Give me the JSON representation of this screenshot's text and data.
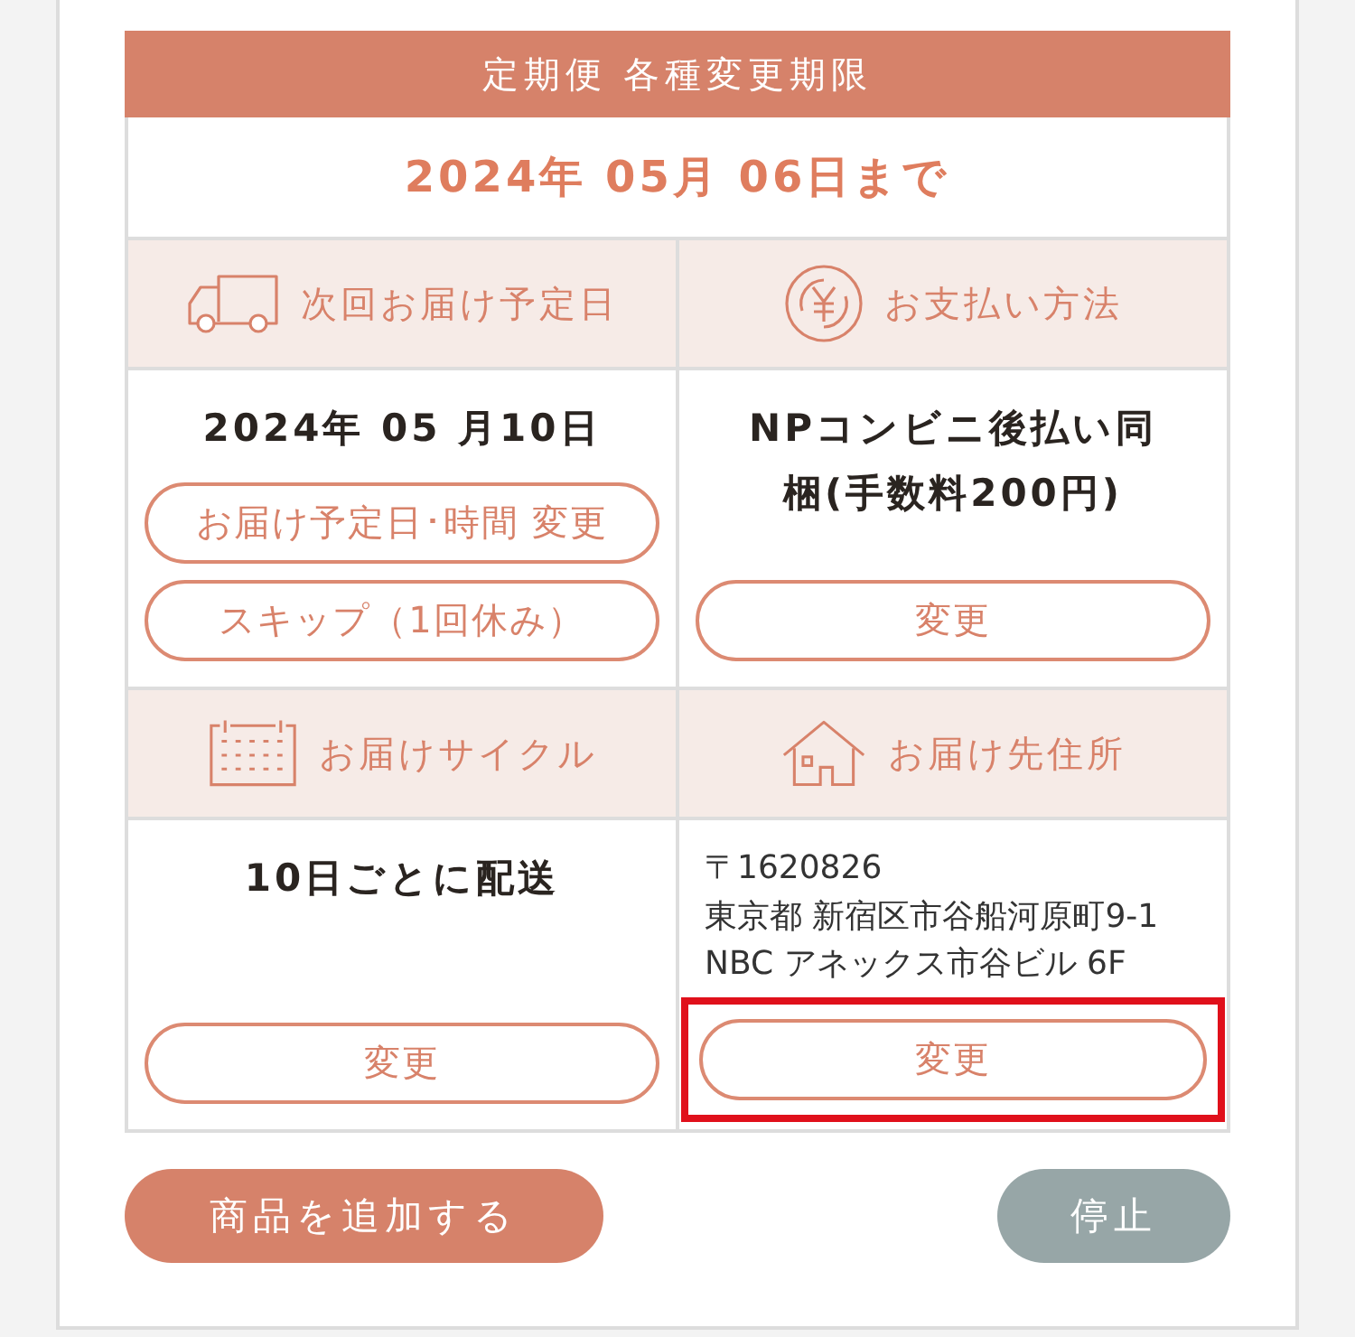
{
  "header": {
    "title": "定期便 各種変更期限",
    "deadline": "2024年 05月 06日まで"
  },
  "sections": [
    {
      "kind": "schedule",
      "label": "次回お届け予定日",
      "value": "2024年 05 月10日",
      "buttons": [
        {
          "label": "お届け予定日･時間 変更",
          "highlighted": false
        },
        {
          "label": "スキップ（1回休み）",
          "highlighted": false
        }
      ]
    },
    {
      "kind": "payment",
      "label": "お支払い方法",
      "value": "NPコンビニ後払い同梱(手数料200円)",
      "buttons": [
        {
          "label": "変更",
          "highlighted": false
        }
      ]
    },
    {
      "kind": "cycle",
      "label": "お届けサイクル",
      "value": "10日ごとに配送",
      "buttons": [
        {
          "label": "変更",
          "highlighted": false
        }
      ]
    },
    {
      "kind": "address",
      "label": "お届け先住所",
      "lines": [
        "〒1620826",
        "東京都 新宿区市谷船河原町9-1",
        "NBC アネックス市谷ビル 6F"
      ],
      "buttons": [
        {
          "label": "変更",
          "highlighted": true
        }
      ]
    }
  ],
  "actions": [
    {
      "label": "商品を追加する",
      "kind": "primary"
    },
    {
      "label": "停止",
      "kind": "secondary"
    }
  ]
}
